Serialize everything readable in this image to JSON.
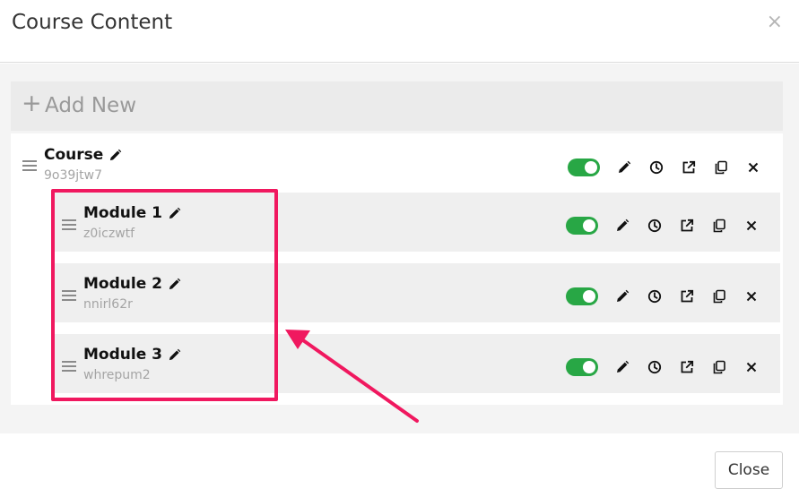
{
  "modal": {
    "title": "Course Content",
    "close_glyph": "×"
  },
  "add_new": {
    "plus_glyph": "+",
    "label": "Add New"
  },
  "course": {
    "title": "Course",
    "id": "9o39jtw7",
    "enabled": true
  },
  "modules": [
    {
      "title": "Module 1",
      "id": "z0iczwtf",
      "enabled": true
    },
    {
      "title": "Module 2",
      "id": "nnirl62r",
      "enabled": true
    },
    {
      "title": "Module 3",
      "id": "whrepum2",
      "enabled": true
    }
  ],
  "row_action_icons": [
    "toggle-switch",
    "pencil-icon",
    "clock-icon",
    "external-link-icon",
    "copy-icon",
    "close-icon"
  ],
  "footer": {
    "close_label": "Close"
  },
  "colors": {
    "toggle_on": "#28a745",
    "highlight": "#f0185f",
    "id_text": "#a4a4a4"
  }
}
